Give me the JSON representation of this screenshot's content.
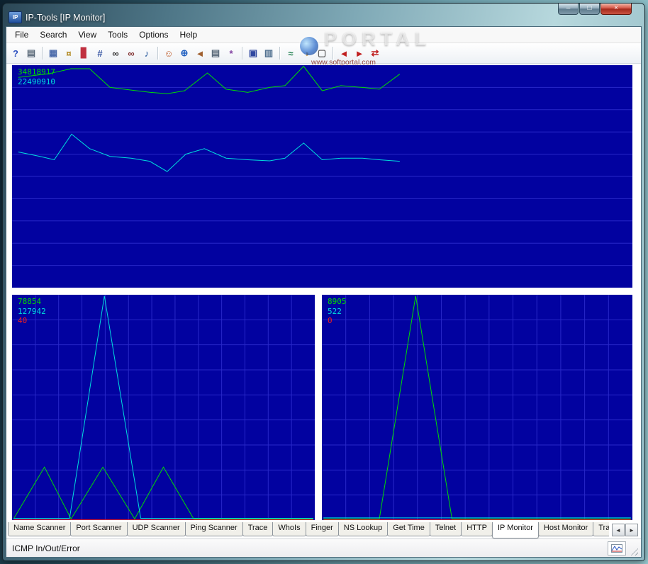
{
  "window": {
    "title": "IP-Tools [IP Monitor]",
    "app_icon_text": "IP",
    "buttons": {
      "minimize": "–",
      "maximize": "□",
      "close": "×"
    }
  },
  "watermark": {
    "brand": "PORTAL",
    "url": "www.softportal.com"
  },
  "menu": {
    "items": [
      "File",
      "Search",
      "View",
      "Tools",
      "Options",
      "Help"
    ]
  },
  "toolbar": {
    "icons": [
      {
        "name": "help-icon",
        "glyph": "?",
        "color": "#2a4fc0"
      },
      {
        "name": "print-icon",
        "glyph": "▤",
        "color": "#5a6a7a"
      },
      {
        "type": "sep"
      },
      {
        "name": "connection-list-icon",
        "glyph": "▦",
        "color": "#4a6aaa"
      },
      {
        "name": "key-icon",
        "glyph": "¤",
        "color": "#b08820"
      },
      {
        "name": "statistics-icon",
        "glyph": "▊",
        "color": "#c03040"
      },
      {
        "name": "interface-icon",
        "glyph": "#",
        "color": "#3050a0"
      },
      {
        "name": "find-icon",
        "glyph": "∞",
        "color": "#303030"
      },
      {
        "name": "find-host-icon",
        "glyph": "∞",
        "color": "#803030"
      },
      {
        "name": "sound-icon",
        "glyph": "♪",
        "color": "#3060a0"
      },
      {
        "type": "sep"
      },
      {
        "name": "clients-icon",
        "glyph": "☺",
        "color": "#c06030"
      },
      {
        "name": "web-icon",
        "glyph": "⊕",
        "color": "#2060c0"
      },
      {
        "name": "exit-icon",
        "glyph": "◄",
        "color": "#a06030"
      },
      {
        "name": "print-report-icon",
        "glyph": "▤",
        "color": "#5a6a7a"
      },
      {
        "name": "settings-icon",
        "glyph": "*",
        "color": "#8040a0"
      },
      {
        "type": "sep"
      },
      {
        "name": "monitor-icon",
        "glyph": "▣",
        "color": "#3048a0"
      },
      {
        "name": "report-icon",
        "glyph": "▥",
        "color": "#507090"
      },
      {
        "type": "sep"
      },
      {
        "name": "graph-icon",
        "glyph": "≈",
        "color": "#208050"
      },
      {
        "name": "pie-chart-icon",
        "glyph": "◑",
        "color": "#c08020"
      },
      {
        "name": "log-icon",
        "glyph": "▢",
        "color": "#606060"
      },
      {
        "type": "sep"
      },
      {
        "name": "prev-icon",
        "glyph": "◄",
        "color": "#c02020"
      },
      {
        "name": "next-icon",
        "glyph": "►",
        "color": "#c02020"
      },
      {
        "name": "swap-icon",
        "glyph": "⇄",
        "color": "#c02020"
      }
    ]
  },
  "tabs": {
    "items": [
      "Name Scanner",
      "Port Scanner",
      "UDP Scanner",
      "Ping Scanner",
      "Trace",
      "WhoIs",
      "Finger",
      "NS Lookup",
      "Get Time",
      "Telnet",
      "HTTP",
      "IP Monitor",
      "Host Monitor",
      "Trap Watche"
    ],
    "active": "IP Monitor",
    "scroll_left": "◄",
    "scroll_right": "►"
  },
  "status": {
    "text": "ICMP In/Out/Error"
  },
  "chart_data": [
    {
      "name": "traffic-history",
      "type": "line",
      "bg": "#0202a0",
      "grid_color": "#2828c8",
      "grid": {
        "rows": 10,
        "cols": 1
      },
      "series": [
        {
          "name": "in",
          "color": "#00dd00",
          "label": "34818917",
          "points": [
            [
              0.01,
              0.055
            ],
            [
              0.06,
              0.038
            ],
            [
              0.095,
              0.016
            ],
            [
              0.125,
              0.016
            ],
            [
              0.158,
              0.1
            ],
            [
              0.192,
              0.112
            ],
            [
              0.222,
              0.122
            ],
            [
              0.25,
              0.128
            ],
            [
              0.278,
              0.115
            ],
            [
              0.315,
              0.035
            ],
            [
              0.345,
              0.108
            ],
            [
              0.38,
              0.122
            ],
            [
              0.415,
              0.1
            ],
            [
              0.44,
              0.092
            ],
            [
              0.47,
              0.005
            ],
            [
              0.5,
              0.115
            ],
            [
              0.53,
              0.092
            ],
            [
              0.565,
              0.1
            ],
            [
              0.592,
              0.108
            ],
            [
              0.625,
              0.04
            ]
          ]
        },
        {
          "name": "out",
          "color": "#00dddd",
          "label": "22490910",
          "points": [
            [
              0.01,
              0.39
            ],
            [
              0.045,
              0.41
            ],
            [
              0.068,
              0.425
            ],
            [
              0.096,
              0.31
            ],
            [
              0.125,
              0.375
            ],
            [
              0.158,
              0.41
            ],
            [
              0.192,
              0.418
            ],
            [
              0.222,
              0.432
            ],
            [
              0.25,
              0.478
            ],
            [
              0.28,
              0.4
            ],
            [
              0.31,
              0.375
            ],
            [
              0.345,
              0.418
            ],
            [
              0.38,
              0.425
            ],
            [
              0.415,
              0.43
            ],
            [
              0.44,
              0.418
            ],
            [
              0.47,
              0.35
            ],
            [
              0.5,
              0.425
            ],
            [
              0.53,
              0.418
            ],
            [
              0.565,
              0.418
            ],
            [
              0.592,
              0.425
            ],
            [
              0.625,
              0.432
            ]
          ]
        }
      ]
    },
    {
      "name": "icmp-left",
      "type": "line",
      "bg": "#0202a0",
      "grid_color": "#2828c8",
      "grid": {
        "rows": 9,
        "cols": 13
      },
      "series": [
        {
          "name": "in",
          "color": "#00dd00",
          "label": "78854",
          "points": [
            [
              0.005,
              0.995
            ],
            [
              0.107,
              0.765
            ],
            [
              0.195,
              0.995
            ],
            [
              0.3,
              0.765
            ],
            [
              0.405,
              0.995
            ],
            [
              0.5,
              0.765
            ],
            [
              0.6,
              0.995
            ],
            [
              0.995,
              0.995
            ]
          ]
        },
        {
          "name": "out",
          "color": "#00dddd",
          "label": "127942",
          "points": [
            [
              0.005,
              0.992
            ],
            [
              0.19,
              0.992
            ],
            [
              0.305,
              0.005
            ],
            [
              0.425,
              0.992
            ],
            [
              0.995,
              0.992
            ]
          ]
        },
        {
          "name": "error",
          "color": "#ee2020",
          "label": "40",
          "points": [
            [
              0.005,
              0.998
            ],
            [
              0.995,
              0.998
            ]
          ]
        }
      ]
    },
    {
      "name": "icmp-right",
      "type": "line",
      "bg": "#0202a0",
      "grid_color": "#2828c8",
      "grid": {
        "rows": 9,
        "cols": 13
      },
      "series": [
        {
          "name": "in",
          "color": "#00dd00",
          "label": "8905",
          "points": [
            [
              0.005,
              0.995
            ],
            [
              0.185,
              0.995
            ],
            [
              0.302,
              0.005
            ],
            [
              0.419,
              0.995
            ],
            [
              0.995,
              0.995
            ]
          ]
        },
        {
          "name": "out",
          "color": "#00dddd",
          "label": "522",
          "points": [
            [
              0.005,
              0.99
            ],
            [
              0.995,
              0.99
            ]
          ]
        },
        {
          "name": "error",
          "color": "#ee2020",
          "label": "0",
          "points": [
            [
              0.005,
              0.998
            ],
            [
              0.995,
              0.998
            ]
          ]
        }
      ]
    }
  ]
}
